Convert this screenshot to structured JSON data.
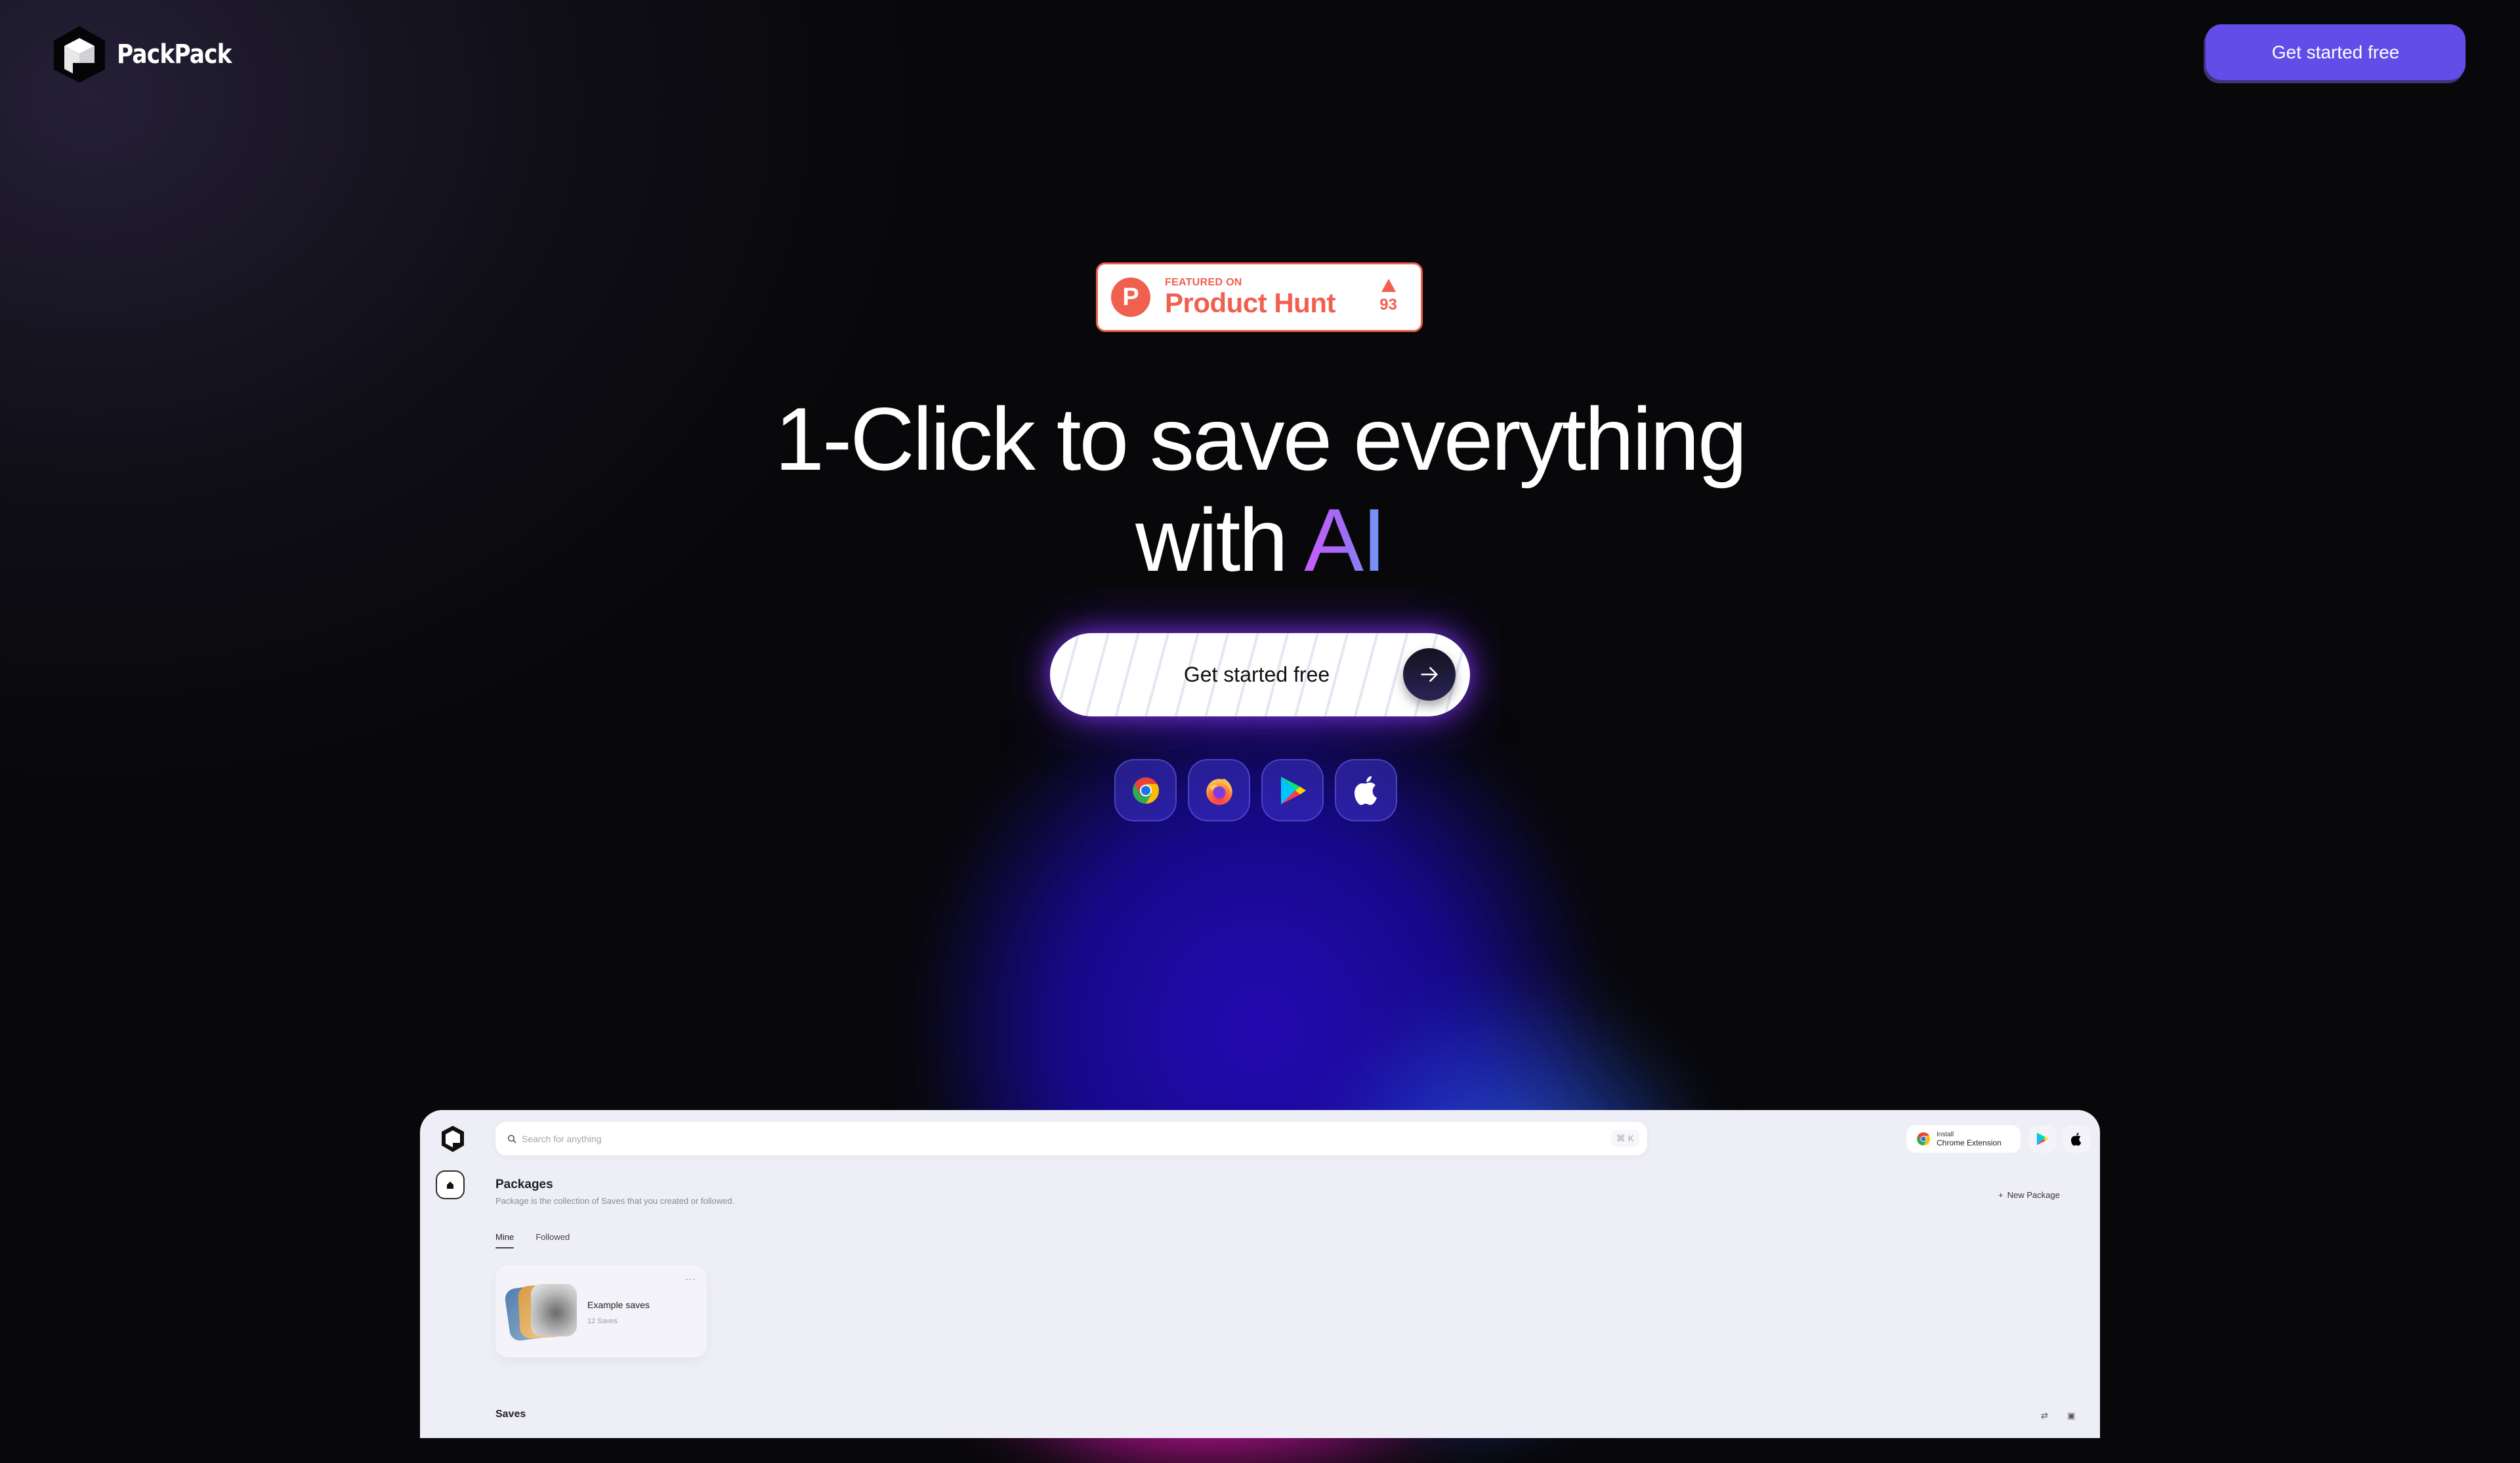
{
  "brand": {
    "name": "PackPack",
    "accent": "#634de9"
  },
  "nav": {
    "cta_label": "Get started free"
  },
  "product_hunt": {
    "featured_label": "FEATURED ON",
    "name": "Product Hunt",
    "upvotes": "93",
    "color": "#f0604f"
  },
  "hero": {
    "headline_line1": "1-Click to save everything",
    "headline_line2_prefix": "with",
    "headline_highlight": "AI",
    "cta_label": "Get started free",
    "cta_icon": "arrow-right-icon"
  },
  "platforms": [
    {
      "name": "Chrome",
      "icon": "chrome-icon"
    },
    {
      "name": "Firefox",
      "icon": "firefox-icon"
    },
    {
      "name": "Google Play",
      "icon": "google-play-icon"
    },
    {
      "name": "Apple",
      "icon": "apple-icon"
    }
  ],
  "app_preview": {
    "search": {
      "placeholder": "Search for anything",
      "value": "",
      "shortcut": "⌘ K"
    },
    "install_ext": {
      "small": "Install",
      "big": "Chrome Extension"
    },
    "section": {
      "title": "Packages",
      "subtitle": "Package is the collection of Saves that you created or followed.",
      "new_button": "New Package",
      "tabs": [
        {
          "label": "Mine",
          "active": true
        },
        {
          "label": "Followed",
          "active": false
        }
      ]
    },
    "cards": [
      {
        "title": "Example saves",
        "count": "12 Saves",
        "menu": "···"
      }
    ],
    "saves_title": "Saves"
  }
}
